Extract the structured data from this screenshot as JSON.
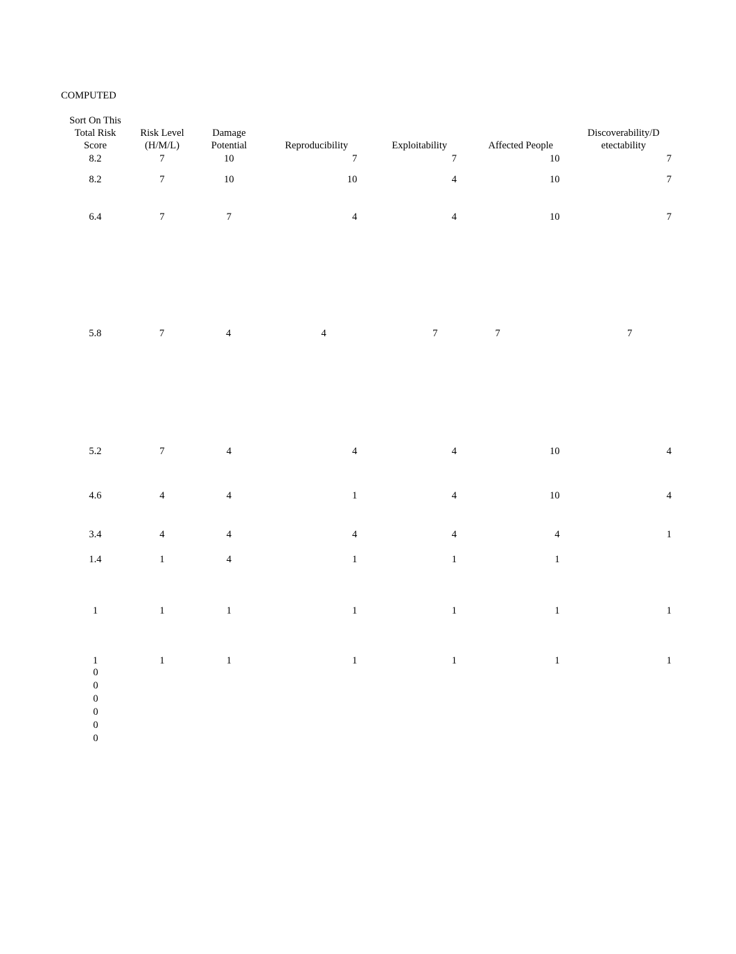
{
  "title": "COMPUTED",
  "headers": {
    "col1_line1": "Sort On This",
    "col1_line2": "Total Risk",
    "col1_line3": "Score",
    "col2_line1": "Risk Level",
    "col2_line2": "(H/M/L)",
    "col3_line1": "Damage",
    "col3_line2": "Potential",
    "col4": "Reproducibility",
    "col5": "Exploitability",
    "col6": "Affected People",
    "col7_line1": "Discoverability/D",
    "col7_line2": "etectability"
  },
  "rows": [
    {
      "c1": "8.2",
      "c2": "7",
      "c3": "10",
      "c4": "7",
      "c5": "7",
      "c6": "10",
      "c7": "7"
    },
    {
      "c1": "8.2",
      "c2": "7",
      "c3": "10",
      "c4": "10",
      "c5": "4",
      "c6": "10",
      "c7": "7"
    },
    {
      "c1": "6.4",
      "c2": "7",
      "c3": "7",
      "c4": "4",
      "c5": "4",
      "c6": "10",
      "c7": "7"
    },
    {
      "c1": "5.8",
      "c2": "7",
      "c3": "4",
      "c4": "4",
      "c5": "7",
      "c6": "7",
      "c7": "7"
    },
    {
      "c1": "5.2",
      "c2": "7",
      "c3": "4",
      "c4": "4",
      "c5": "4",
      "c6": "10",
      "c7": "4"
    },
    {
      "c1": "4.6",
      "c2": "4",
      "c3": "4",
      "c4": "1",
      "c5": "4",
      "c6": "10",
      "c7": "4"
    },
    {
      "c1": "3.4",
      "c2": "4",
      "c3": "4",
      "c4": "4",
      "c5": "4",
      "c6": "4",
      "c7": "1"
    },
    {
      "c1": "1.4",
      "c2": "1",
      "c3": "4",
      "c4": "1",
      "c5": "1",
      "c6": "1",
      "c7": ""
    },
    {
      "c1": "1",
      "c2": "1",
      "c3": "1",
      "c4": "1",
      "c5": "1",
      "c6": "1",
      "c7": "1"
    },
    {
      "c1": "1",
      "c2": "1",
      "c3": "1",
      "c4": "1",
      "c5": "1",
      "c6": "1",
      "c7": "1"
    }
  ],
  "zeros": [
    "0",
    "0",
    "0",
    "0",
    "0",
    "0"
  ]
}
